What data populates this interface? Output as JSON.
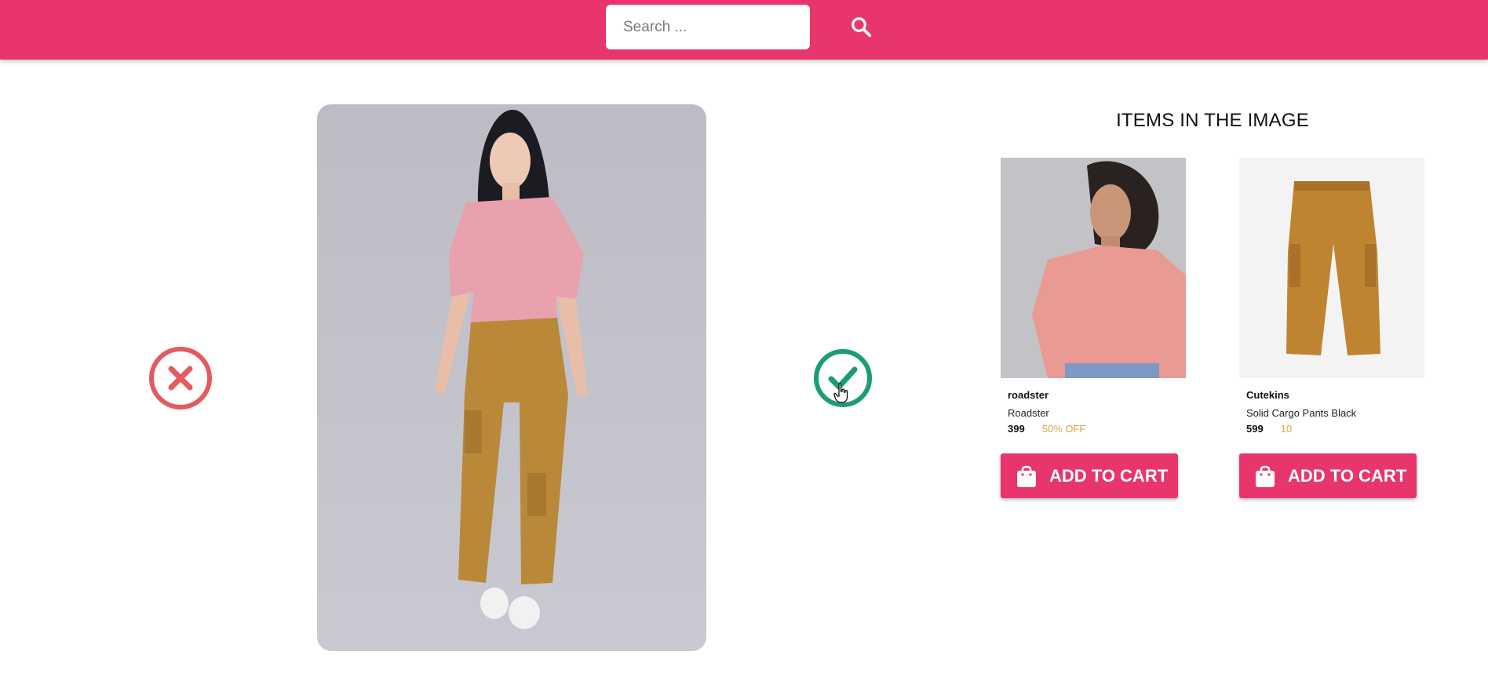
{
  "search": {
    "placeholder": "Search ..."
  },
  "icons": {
    "search": "search-icon",
    "reject": "close-circle-icon",
    "accept": "check-circle-icon",
    "cart": "shopping-bag-icon"
  },
  "colors": {
    "brand": "#e8366c",
    "reject": "#e35a5f",
    "accept": "#1b9e6e",
    "discount": "#e0a44a"
  },
  "items_section": {
    "heading": "ITEMS IN THE IMAGE",
    "products": [
      {
        "brand": "roadster",
        "name": "Roadster",
        "price": "399",
        "discount": "50% OFF",
        "cart_label": "ADD TO CART"
      },
      {
        "brand": "Cutekins",
        "name": "Solid Cargo Pants Black",
        "price": "599",
        "discount": "10",
        "cart_label": "ADD TO CART"
      }
    ]
  }
}
